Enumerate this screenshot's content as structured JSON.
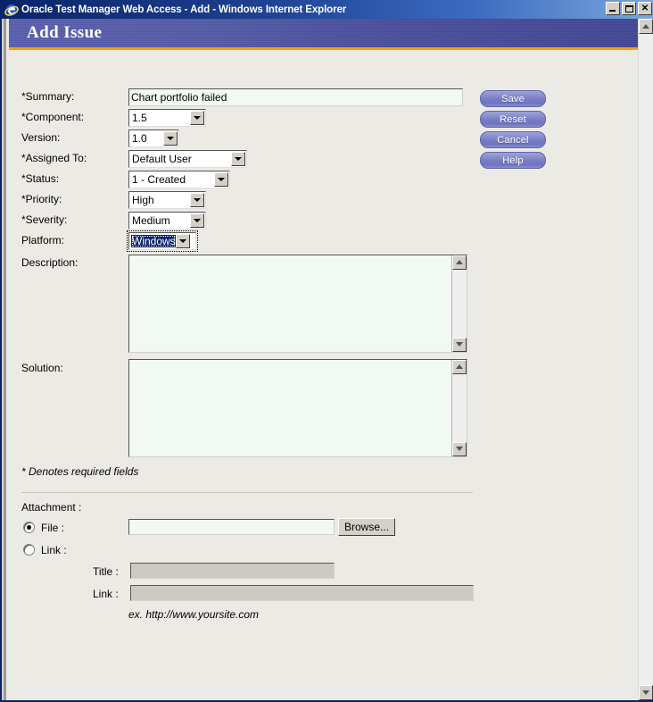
{
  "window": {
    "title": "Oracle Test Manager Web Access - Add - Windows Internet Explorer",
    "icon": "ie-logo-icon",
    "minimize_label": "Minimize",
    "maximize_label": "Maximize",
    "close_label": "Close"
  },
  "page": {
    "header_title": "Add Issue",
    "accent_band": "#4a4f9e",
    "accent_underline": "#f0a500",
    "background": "#eceae4",
    "input_background": "#f2f8f2"
  },
  "form": {
    "fields": [
      {
        "label": "*Summary:",
        "type": "text",
        "value": "Chart portfolio failed"
      },
      {
        "label": "*Component:",
        "type": "select",
        "value": "1.5"
      },
      {
        "label": "Version:",
        "type": "select",
        "value": "1.0"
      },
      {
        "label": "*Assigned To:",
        "type": "select",
        "value": "Default User"
      },
      {
        "label": "*Status:",
        "type": "select",
        "value": "1 - Created"
      },
      {
        "label": "*Priority:",
        "type": "select",
        "value": "High"
      },
      {
        "label": "*Severity:",
        "type": "select",
        "value": "Medium"
      },
      {
        "label": "Platform:",
        "type": "select",
        "value": "Windows",
        "focused": true
      },
      {
        "label": "Description:",
        "type": "textarea",
        "value": ""
      },
      {
        "label": "Solution:",
        "type": "textarea",
        "value": ""
      }
    ],
    "required_note": "* Denotes required fields"
  },
  "buttons": {
    "save": "Save",
    "reset": "Reset",
    "cancel": "Cancel",
    "help": "Help"
  },
  "attachment": {
    "section_label": "Attachment :",
    "file_radio_label": "File :",
    "file_value": "",
    "browse_label": "Browse...",
    "link_radio_label": "Link :",
    "title_label": "Title :",
    "title_value": "",
    "link_label": "Link :",
    "link_value": "",
    "example_text": "ex. http://www.yoursite.com",
    "selected_option": "file"
  }
}
